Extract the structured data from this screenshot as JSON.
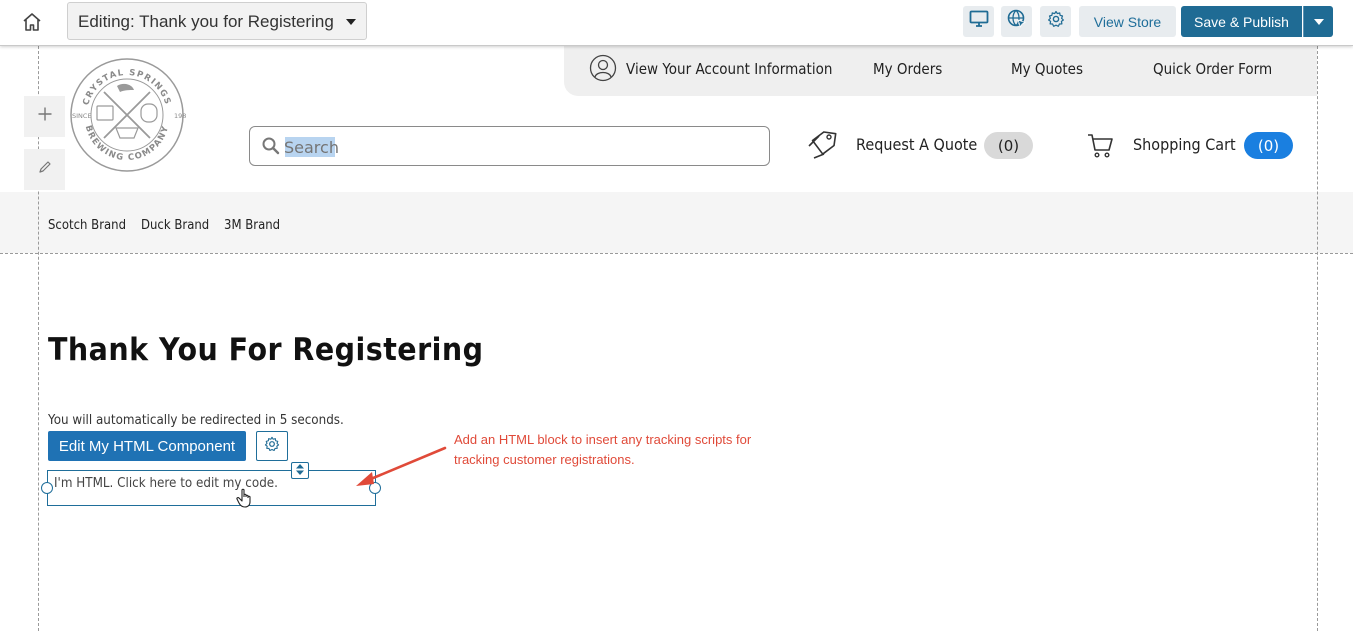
{
  "editor": {
    "page_select_value": "Editing: Thank you for Registering",
    "view_store_label": "View Store",
    "save_publish_label": "Save & Publish",
    "icons": [
      "home-icon",
      "desktop-icon",
      "globe-cursor-icon",
      "gear-icon",
      "plus-icon",
      "pencil-icon"
    ]
  },
  "header": {
    "account_links": [
      "View Your Account Information",
      "My Orders",
      "My Quotes",
      "Quick Order Form"
    ],
    "search_placeholder": "Search",
    "request_quote_label": "Request A Quote",
    "request_quote_count": "(0)",
    "cart_label": "Shopping Cart",
    "cart_count": "(0)",
    "logo": {
      "top_text": "CRYSTAL SPRINGS",
      "bottom_text": "BREWING COMPANY",
      "left_text": "SINCE",
      "right_text": "1988"
    }
  },
  "brand_nav": [
    "Scotch Brand",
    "Duck Brand",
    "3M Brand"
  ],
  "content": {
    "title": "Thank You For Registering",
    "redirect_text": "You will automatically be redirected in 5 seconds.",
    "edit_button_label": "Edit My HTML Component",
    "html_block_text": "I'm HTML. Click here to edit my code.",
    "annotation": "Add an HTML block to insert any tracking scripts for tracking customer registrations."
  },
  "colors": {
    "primary": "#1f6b94",
    "edit_button": "#1f72b4",
    "cart_badge": "#1a7fe0",
    "annotation": "#e04a39"
  }
}
